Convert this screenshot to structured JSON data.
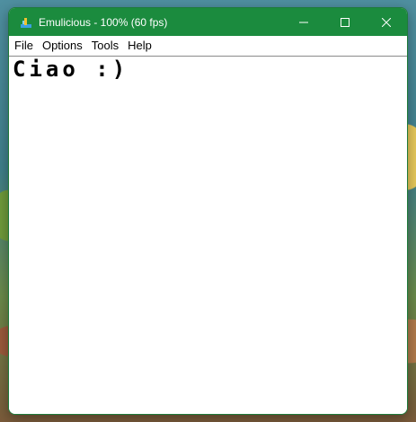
{
  "window": {
    "title": "Emulicious - 100% (60 fps)",
    "app_icon": "emulicious-icon",
    "controls": [
      "minimize-icon",
      "maximize-icon",
      "close-icon"
    ]
  },
  "menubar": {
    "items": [
      {
        "label": "File"
      },
      {
        "label": "Options"
      },
      {
        "label": "Tools"
      },
      {
        "label": "Help"
      }
    ]
  },
  "screen": {
    "text": "Ciao :)"
  },
  "colors": {
    "titlebar": "#1b8b3e",
    "screen_bg": "#ffffff",
    "screen_text": "#000000"
  }
}
